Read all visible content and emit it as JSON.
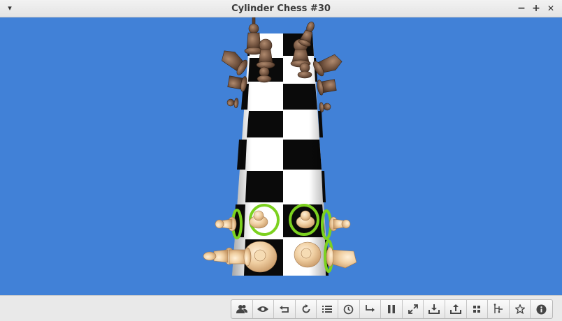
{
  "window": {
    "title": "Cylinder Chess #30",
    "menu_glyph": "▾",
    "minimize_glyph": "−",
    "maximize_glyph": "+",
    "close_glyph": "✕"
  },
  "board": {
    "background_color": "#4181d7",
    "dark_square_color": "#000000",
    "light_square_color": "#ffffff",
    "black_pieces": "wooden dark brown",
    "white_pieces": "light maple",
    "highlight_color": "#7cd11f"
  },
  "toolbar": {
    "buttons": [
      {
        "id": "players",
        "icon": "players-icon"
      },
      {
        "id": "view",
        "icon": "eye-icon"
      },
      {
        "id": "undo",
        "icon": "undo-icon"
      },
      {
        "id": "restart",
        "icon": "refresh-icon"
      },
      {
        "id": "moves",
        "icon": "list-icon"
      },
      {
        "id": "clock",
        "icon": "clock-icon"
      },
      {
        "id": "redo",
        "icon": "redo-icon"
      },
      {
        "id": "pause",
        "icon": "pause-icon"
      },
      {
        "id": "fullscreen",
        "icon": "fullscreen-icon"
      },
      {
        "id": "download",
        "icon": "download-icon"
      },
      {
        "id": "upload",
        "icon": "upload-icon"
      },
      {
        "id": "boards",
        "icon": "grid-icon"
      },
      {
        "id": "hint",
        "icon": "hint-icon"
      },
      {
        "id": "favorite",
        "icon": "star-icon"
      },
      {
        "id": "info",
        "icon": "info-icon"
      }
    ]
  }
}
